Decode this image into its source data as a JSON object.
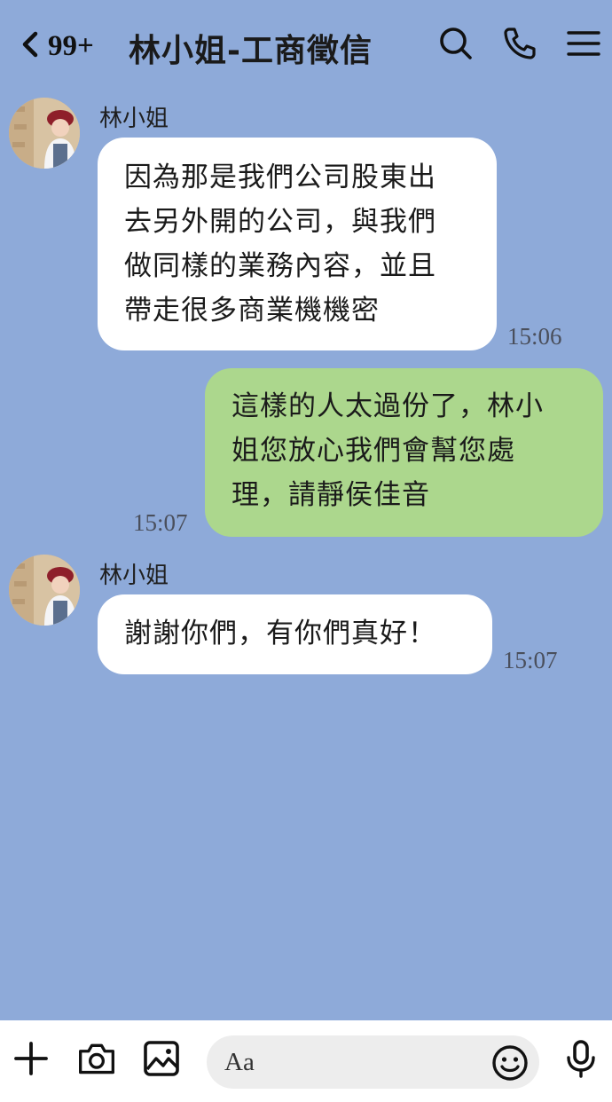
{
  "header": {
    "unread_count": "99+",
    "title": "林小姐-工商徵信",
    "icons": [
      "back-chevron-icon",
      "search-icon",
      "phone-icon",
      "menu-icon"
    ]
  },
  "messages": [
    {
      "direction": "incoming",
      "sender": "林小姐",
      "lines": [
        "因為那是我們公司股東出",
        "去另外開的公司，與我們",
        "做同樣的業務內容，並且",
        "帶走很多商業機機密"
      ],
      "time": "15:06"
    },
    {
      "direction": "outgoing",
      "lines": [
        "這樣的人太過份了，林小",
        "姐您放心我們會幫您處",
        "理，請靜侯佳音"
      ],
      "time": "15:07"
    },
    {
      "direction": "incoming",
      "sender": "林小姐",
      "lines": [
        "謝謝你們，有你們真好！"
      ],
      "time": "15:07"
    }
  ],
  "input": {
    "placeholder": "Aa",
    "icons": [
      "plus-icon",
      "camera-icon",
      "image-icon",
      "emoji-icon",
      "microphone-icon"
    ]
  },
  "colors": {
    "background": "#8eaad9",
    "incoming_bubble": "#ffffff",
    "outgoing_bubble": "#acd78d",
    "input_bar": "#ffffff",
    "input_field": "#ededed"
  }
}
